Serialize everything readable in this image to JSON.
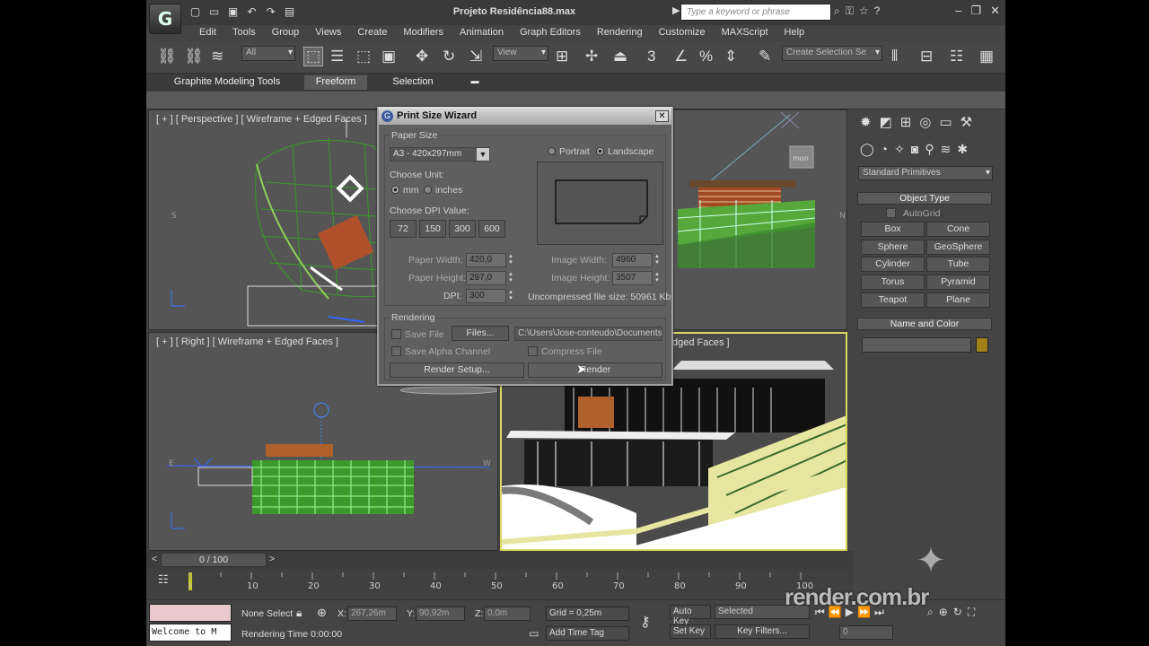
{
  "app": {
    "title": "Projeto Residência88.max",
    "logo_glyph": "G",
    "search_placeholder": "Type a keyword or phrase"
  },
  "menu": [
    "Edit",
    "Tools",
    "Group",
    "Views",
    "Create",
    "Modifiers",
    "Animation",
    "Graph Editors",
    "Rendering",
    "Customize",
    "MAXScript",
    "Help"
  ],
  "toolbar": {
    "selection_filter": "All",
    "ref_coord": "View",
    "named_selection": "Create Selection Se",
    "snap_3d": "3"
  },
  "ribbon": {
    "tabs": [
      "Graphite Modeling Tools",
      "Freeform",
      "Selection"
    ],
    "active_tab": "Freeform"
  },
  "viewports": {
    "perspective": "[ + ] [ Perspective ] [ Wireframe + Edged Faces ]",
    "right": "[ + ] [ Right ] [ Wireframe + Edged Faces ]",
    "camera_partial": "dged Faces ]",
    "axis_s": "S",
    "axis_e": "E",
    "axis_w": "W",
    "axis_n": "N",
    "viewcube": "mon"
  },
  "dialog": {
    "title": "Print Size Wizard",
    "paper_size_group": "Paper Size",
    "paper_size_value": "A3 - 420x297mm",
    "portrait": "Portrait",
    "landscape": "Landscape",
    "choose_unit": "Choose Unit:",
    "mm": "mm",
    "inches": "inches",
    "choose_dpi": "Choose DPI Value:",
    "dpi_options": [
      "72",
      "150",
      "300",
      "600"
    ],
    "paper_width_label": "Paper Width:",
    "paper_width": "420,0",
    "paper_height_label": "Paper Height:",
    "paper_height": "297,0",
    "dpi_label": "DPI:",
    "dpi": "300",
    "image_width_label": "Image Width:",
    "image_width": "4960",
    "image_height_label": "Image Height:",
    "image_height": "3507",
    "uncompressed": "Uncompressed file size: 50961 Kb",
    "rendering_group": "Rendering",
    "save_file": "Save File",
    "files_button": "Files...",
    "file_path": "C:\\Users\\Jose-conteudo\\Documents",
    "save_alpha": "Save Alpha Channel",
    "compress_file": "Compress File",
    "render_setup": "Render Setup...",
    "render": "Render"
  },
  "command_panel": {
    "category": "Standard Primitives",
    "object_type": "Object Type",
    "autogrid": "AutoGrid",
    "buttons": [
      "Box",
      "Cone",
      "Sphere",
      "GeoSphere",
      "Cylinder",
      "Tube",
      "Torus",
      "Pyramid",
      "Teapot",
      "Plane"
    ],
    "name_color": "Name and Color",
    "swatch_color": "#a08018"
  },
  "timeline": {
    "frame": "0 / 100",
    "prev": "<",
    "next": ">",
    "ticks": [
      "0",
      "10",
      "20",
      "30",
      "40",
      "50",
      "60",
      "70",
      "80",
      "90",
      "100"
    ]
  },
  "status": {
    "maxscript": "Welcome to M",
    "selection": "None Select",
    "x_label": "X:",
    "x": "267,26m",
    "y_label": "Y:",
    "y": "90,92m",
    "z_label": "Z:",
    "z": "0,0m",
    "grid": "Grid = 0,25m",
    "rendering_time": "Rendering Time  0:00:00",
    "add_time_tag": "Add Time Tag",
    "auto_key": "Auto Key",
    "set_key": "Set Key",
    "selected": "Selected",
    "key_filters": "Key Filters...",
    "frame_field": "0"
  },
  "watermark": "render.com.br"
}
